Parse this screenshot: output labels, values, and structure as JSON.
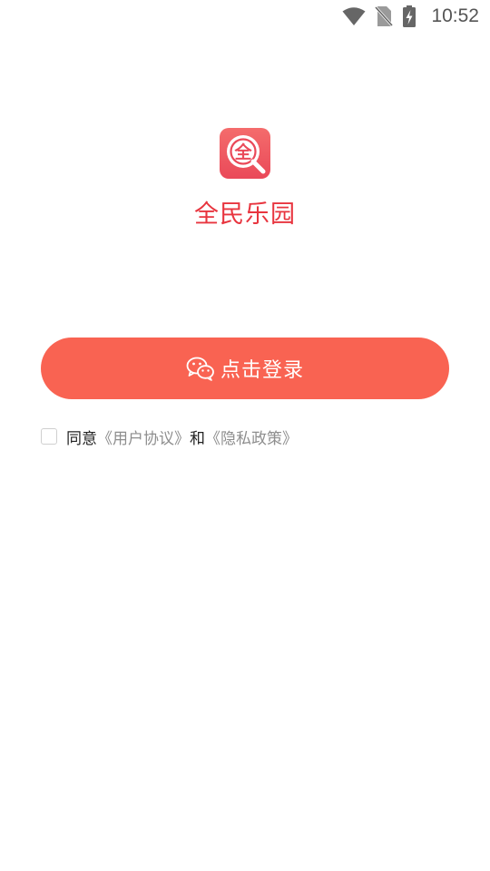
{
  "status_bar": {
    "time": "10:52",
    "icons": [
      "wifi-icon",
      "no-sim-icon",
      "battery-charging-icon"
    ]
  },
  "app": {
    "logo_glyph": "全",
    "name": "全民乐园"
  },
  "login": {
    "icon": "wechat-icon",
    "label": "点击登录"
  },
  "agreement": {
    "prefix": "同意",
    "user_agreement": "《用户协议》",
    "conjunction": "和",
    "privacy_policy": "《隐私政策》",
    "checked": false
  },
  "colors": {
    "brand_red": "#e8353f",
    "button": "#f96352",
    "link_gray": "#8e8e8e"
  }
}
